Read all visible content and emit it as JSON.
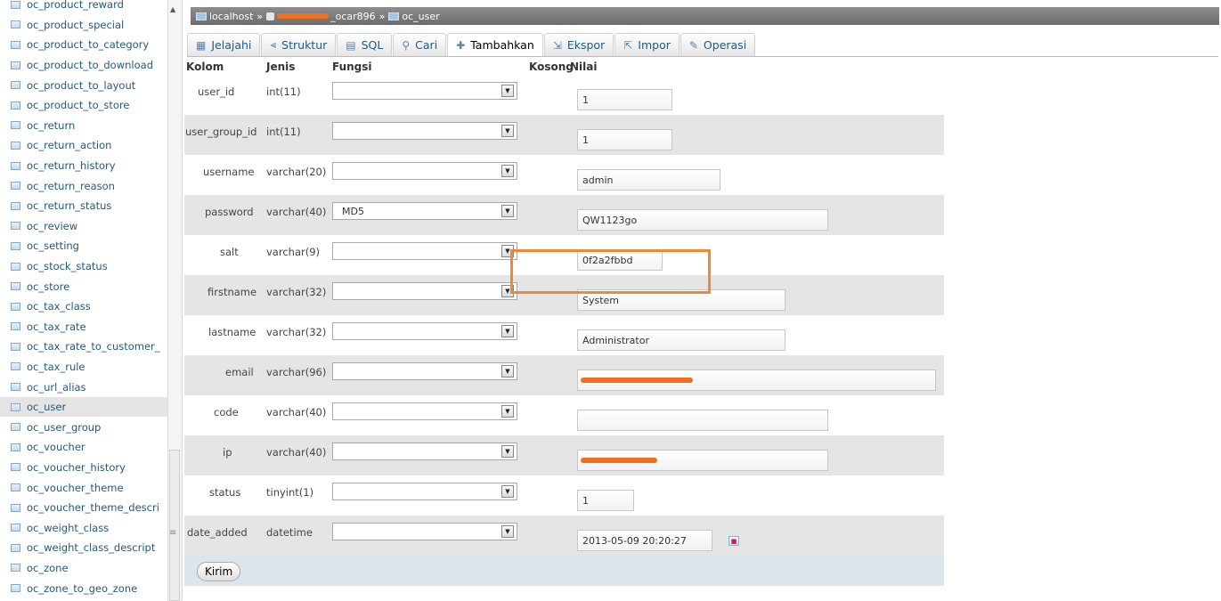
{
  "sidebar": {
    "items": [
      {
        "label": "oc_product_reward"
      },
      {
        "label": "oc_product_special"
      },
      {
        "label": "oc_product_to_category"
      },
      {
        "label": "oc_product_to_download"
      },
      {
        "label": "oc_product_to_layout"
      },
      {
        "label": "oc_product_to_store"
      },
      {
        "label": "oc_return"
      },
      {
        "label": "oc_return_action"
      },
      {
        "label": "oc_return_history"
      },
      {
        "label": "oc_return_reason"
      },
      {
        "label": "oc_return_status"
      },
      {
        "label": "oc_review"
      },
      {
        "label": "oc_setting"
      },
      {
        "label": "oc_stock_status"
      },
      {
        "label": "oc_store"
      },
      {
        "label": "oc_tax_class"
      },
      {
        "label": "oc_tax_rate"
      },
      {
        "label": "oc_tax_rate_to_customer_"
      },
      {
        "label": "oc_tax_rule"
      },
      {
        "label": "oc_url_alias"
      },
      {
        "label": "oc_user"
      },
      {
        "label": "oc_user_group"
      },
      {
        "label": "oc_voucher"
      },
      {
        "label": "oc_voucher_history"
      },
      {
        "label": "oc_voucher_theme"
      },
      {
        "label": "oc_voucher_theme_descri"
      },
      {
        "label": "oc_weight_class"
      },
      {
        "label": "oc_weight_class_descript"
      },
      {
        "label": "oc_zone"
      },
      {
        "label": "oc_zone_to_geo_zone"
      }
    ],
    "active_index": 20
  },
  "breadcrumb": {
    "server": "localhost",
    "separator": "»",
    "database_suffix": "_ocar896",
    "table": "oc_user"
  },
  "tabs": [
    {
      "label": "Jelajahi",
      "icon": "browse-icon"
    },
    {
      "label": "Struktur",
      "icon": "structure-icon"
    },
    {
      "label": "SQL",
      "icon": "sql-icon"
    },
    {
      "label": "Cari",
      "icon": "search-icon"
    },
    {
      "label": "Tambahkan",
      "icon": "insert-icon",
      "active": true
    },
    {
      "label": "Ekspor",
      "icon": "export-icon"
    },
    {
      "label": "Impor",
      "icon": "import-icon"
    },
    {
      "label": "Operasi",
      "icon": "operations-icon"
    }
  ],
  "form": {
    "headers": {
      "column": "Kolom",
      "type": "Jenis",
      "function": "Fungsi",
      "null": "Kosong",
      "value": "Nilai"
    },
    "rows": [
      {
        "column": "user_id",
        "type": "int(11)",
        "function": "",
        "value": "1"
      },
      {
        "column": "user_group_id",
        "type": "int(11)",
        "function": "",
        "value": "1"
      },
      {
        "column": "username",
        "type": "varchar(20)",
        "function": "",
        "value": "admin"
      },
      {
        "column": "password",
        "type": "varchar(40)",
        "function": "MD5",
        "value": "QW1123go"
      },
      {
        "column": "salt",
        "type": "varchar(9)",
        "function": "",
        "value": "0f2a2fbbd"
      },
      {
        "column": "firstname",
        "type": "varchar(32)",
        "function": "",
        "value": "System"
      },
      {
        "column": "lastname",
        "type": "varchar(32)",
        "function": "",
        "value": "Administrator"
      },
      {
        "column": "email",
        "type": "varchar(96)",
        "function": "",
        "value": ""
      },
      {
        "column": "code",
        "type": "varchar(40)",
        "function": "",
        "value": ""
      },
      {
        "column": "ip",
        "type": "varchar(40)",
        "function": "",
        "value": ""
      },
      {
        "column": "status",
        "type": "tinyint(1)",
        "function": "",
        "value": "1"
      },
      {
        "column": "date_added",
        "type": "datetime",
        "function": "",
        "value": "2013-05-09 20:20:27"
      }
    ],
    "submit_label": "Kirim"
  },
  "colors": {
    "highlight": "#f0883a",
    "redaction": "#f07020",
    "link": "#235a81"
  }
}
